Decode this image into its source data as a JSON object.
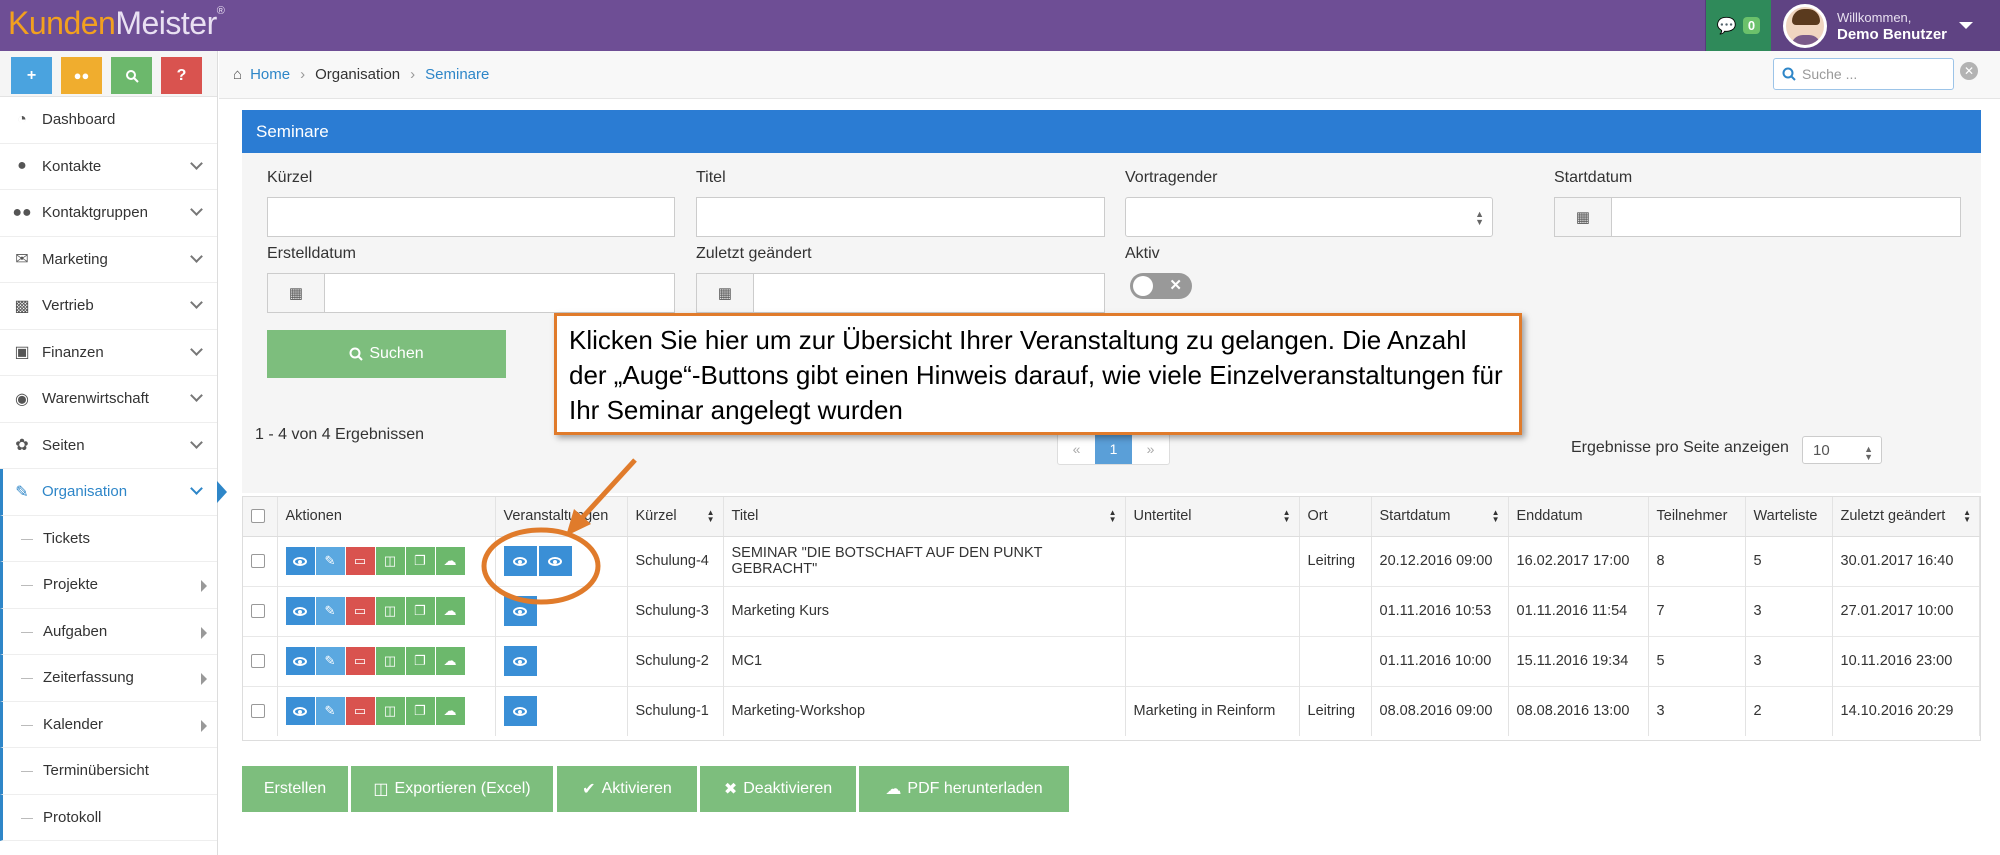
{
  "app": {
    "logo_part1": "Kunden",
    "logo_part2": "Meister",
    "logo_reg": "®",
    "messages_count": "0",
    "welcome": "Willkommen,",
    "user_name": "Demo Benutzer"
  },
  "quick_buttons": [
    {
      "label": "+",
      "icon": "plus-icon",
      "color": "#4aa3df"
    },
    {
      "label": "💬",
      "icon": "chat-icon",
      "color": "#f0ad2e"
    },
    {
      "label": "🔍",
      "icon": "search-icon",
      "color": "#6cb86c"
    },
    {
      "label": "?",
      "icon": "help-icon",
      "color": "#d9534f"
    }
  ],
  "nav": [
    {
      "label": "Dashboard",
      "icon": "dashboard-icon"
    },
    {
      "label": "Kontakte",
      "icon": "user-icon"
    },
    {
      "label": "Kontaktgruppen",
      "icon": "users-icon"
    },
    {
      "label": "Marketing",
      "icon": "envelope-icon"
    },
    {
      "label": "Vertrieb",
      "icon": "bar-chart-icon"
    },
    {
      "label": "Finanzen",
      "icon": "money-icon"
    },
    {
      "label": "Warenwirtschaft",
      "icon": "globe-icon"
    },
    {
      "label": "Seiten",
      "icon": "leaf-icon"
    },
    {
      "label": "Organisation",
      "icon": "edit-icon"
    }
  ],
  "subnav": [
    {
      "label": "Tickets"
    },
    {
      "label": "Projekte"
    },
    {
      "label": "Aufgaben"
    },
    {
      "label": "Zeiterfassung"
    },
    {
      "label": "Kalender"
    },
    {
      "label": "Terminübersicht"
    },
    {
      "label": "Protokoll"
    }
  ],
  "breadcrumb": {
    "home": "Home",
    "level2": "Organisation",
    "current": "Seminare"
  },
  "search": {
    "placeholder": "Suche ..."
  },
  "panel": {
    "title": "Seminare"
  },
  "filters": {
    "kuerzel": "Kürzel",
    "titel": "Titel",
    "vortragender": "Vortragender",
    "startdatum": "Startdatum",
    "erstelldatum": "Erstelldatum",
    "zuletzt": "Zuletzt geändert",
    "aktiv": "Aktiv",
    "suchen": "Suchen"
  },
  "results": {
    "info": "1 - 4 von 4 Ergebnissen",
    "prev": "«",
    "page": "1",
    "next": "»",
    "per_page_label": "Ergebnisse pro Seite anzeigen",
    "per_page_value": "10"
  },
  "table": {
    "headers": [
      "Aktionen",
      "Veranstaltungen",
      "Kürzel",
      "Titel",
      "Untertitel",
      "Ort",
      "Startdatum",
      "Enddatum",
      "Teilnehmer",
      "Warteliste",
      "Zuletzt geändert"
    ],
    "rows": [
      {
        "eyes": 2,
        "kuerzel": "Schulung-4",
        "titel": "SEMINAR \"DIE BOTSCHAFT AUF DEN PUNKT GEBRACHT\"",
        "untertitel": "",
        "ort": "Leitring",
        "start": "20.12.2016 09:00",
        "ende": "16.02.2017 17:00",
        "teilnehmer": "8",
        "warteliste": "5",
        "geaendert": "30.01.2017 16:40"
      },
      {
        "eyes": 1,
        "kuerzel": "Schulung-3",
        "titel": "Marketing Kurs",
        "untertitel": "",
        "ort": "",
        "start": "01.11.2016 10:53",
        "ende": "01.11.2016 11:54",
        "teilnehmer": "7",
        "warteliste": "3",
        "geaendert": "27.01.2017 10:00"
      },
      {
        "eyes": 1,
        "kuerzel": "Schulung-2",
        "titel": "MC1",
        "untertitel": "",
        "ort": "",
        "start": "01.11.2016 10:00",
        "ende": "15.11.2016 19:34",
        "teilnehmer": "5",
        "warteliste": "3",
        "geaendert": "10.11.2016 23:00"
      },
      {
        "eyes": 1,
        "kuerzel": "Schulung-1",
        "titel": "Marketing-Workshop",
        "untertitel": "Marketing in Reinform",
        "ort": "Leitring",
        "start": "08.08.2016 09:00",
        "ende": "08.08.2016 13:00",
        "teilnehmer": "3",
        "warteliste": "2",
        "geaendert": "14.10.2016 20:29"
      }
    ]
  },
  "bottom_buttons": {
    "erstellen": "Erstellen",
    "exportieren": "Exportieren (Excel)",
    "aktivieren": "Aktivieren",
    "deaktivieren": "Deaktivieren",
    "pdf": "PDF herunterladen"
  },
  "callout": {
    "text": "Klicken Sie hier um zur Übersicht Ihrer Veranstaltung zu gelangen. Die Anzahl der „Auge“-Buttons gibt einen Hinweis darauf, wie viele Einzelveranstaltungen für Ihr Seminar angelegt wurden"
  },
  "colors": {
    "brand": "#6e4e95",
    "accent": "#2b7cd3",
    "success": "#7dbe7d",
    "annotation": "#e07b2b"
  }
}
